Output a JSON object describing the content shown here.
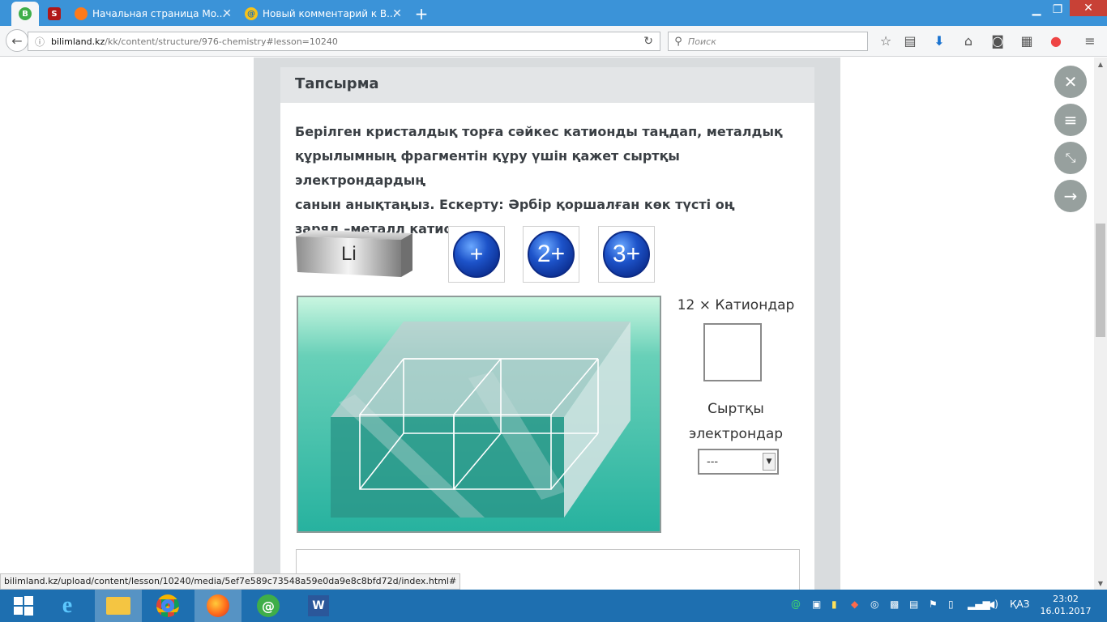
{
  "browser": {
    "tabs": [
      {
        "label": "",
        "icon": "bilimland-icon"
      },
      {
        "label": "",
        "icon": "s-red-icon"
      },
      {
        "label": "Начальная страница Mo...",
        "icon": "firefox-icon"
      },
      {
        "label": "Новый комментарий к В...",
        "icon": "mail-at-icon"
      }
    ],
    "new_tab": "+",
    "url_host": "bilimland.kz",
    "url_path": "/kk/content/structure/976-chemistry#lesson=10240",
    "search_placeholder": "Поиск"
  },
  "panel": {
    "header": "Тапсырма",
    "task_lines": [
      "Берілген кристалдық торға сәйкес катионды таңдап, металдық",
      "құрылымның фрагментін құру үшін қажет сыртқы электрондардың",
      "санын анықтаңыз. Ескерту: Әрбір қоршалған көк түсті оң",
      "заряд  –металл катионы."
    ],
    "element_label": "Li",
    "cations": [
      "+",
      "2+",
      "3+"
    ],
    "count_label": "12 × Катиондар",
    "electrons_label_1": "Сыртқы",
    "electrons_label_2": "электрондар",
    "select_value": "---"
  },
  "status_url": "bilimland.kz/upload/content/lesson/10240/media/5ef7e589c73548a59e0da9e8c8bfd72d/index.html#",
  "side_buttons": [
    "close-icon",
    "menu-icon",
    "collapse-icon",
    "arrow-right-icon"
  ],
  "taskbar": {
    "lang": "ҚАЗ",
    "time": "23:02",
    "date": "16.01.2017"
  },
  "colors": {
    "titlebar": "#3b93d8",
    "taskbar": "#1e6fb0",
    "sphere": "#1d53c9",
    "crystal_bg": "#26b3a0"
  }
}
